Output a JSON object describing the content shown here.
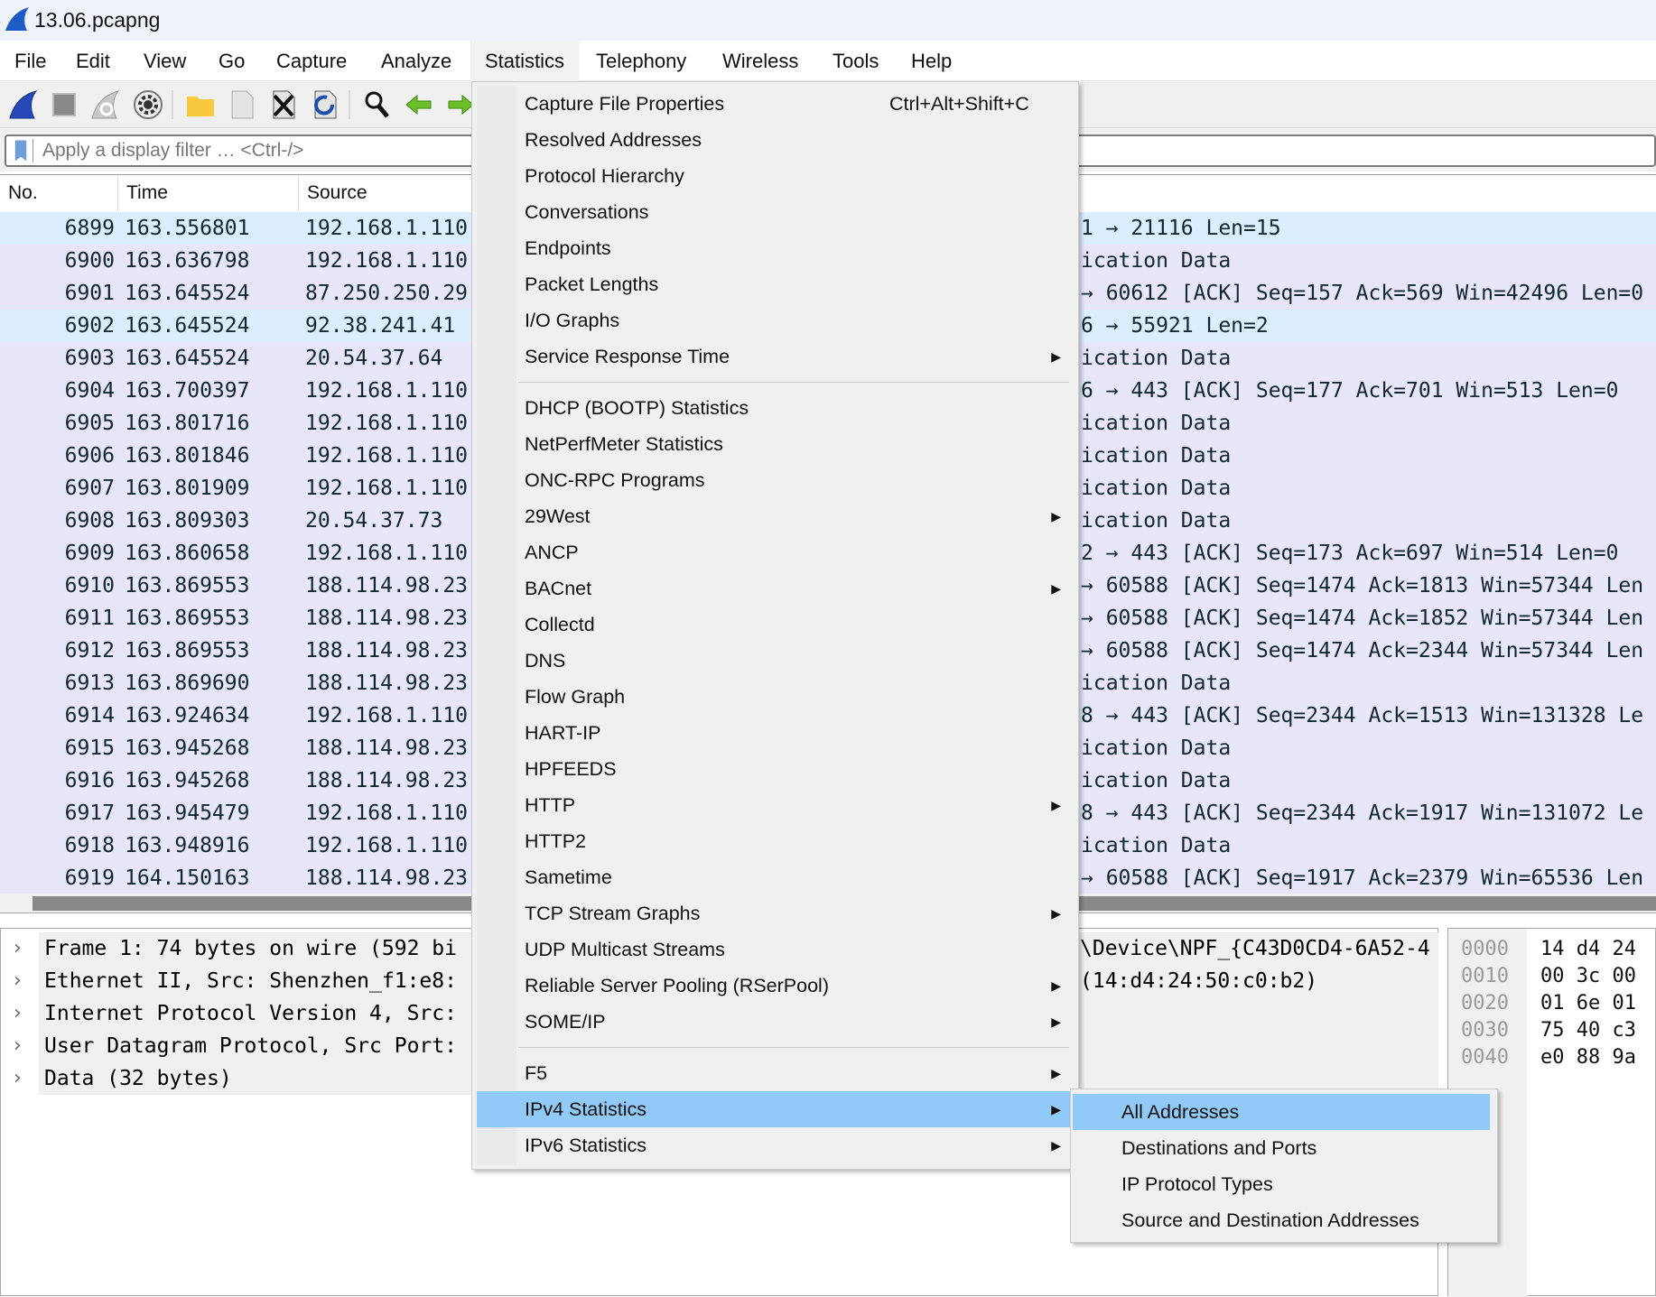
{
  "window": {
    "title": "13.06.pcapng",
    "icon": "wireshark-fin-icon"
  },
  "menubar": [
    "File",
    "Edit",
    "View",
    "Go",
    "Capture",
    "Analyze",
    "Statistics",
    "Telephony",
    "Wireless",
    "Tools",
    "Help"
  ],
  "menubar_active": "Statistics",
  "toolbar": [
    "start-capture-icon",
    "stop-capture-icon",
    "restart-capture-icon",
    "capture-options-icon",
    "open-file-icon",
    "save-file-icon",
    "close-file-icon",
    "reload-file-icon",
    "find-packet-icon",
    "go-back-icon",
    "go-forward-icon"
  ],
  "filter": {
    "placeholder": "Apply a display filter … <Ctrl-/>",
    "value": ""
  },
  "columns": [
    "No.",
    "Time",
    "Source"
  ],
  "colors": {
    "udp_row": "#dbeeff",
    "tcp_row": "#e7e6fb",
    "highlight": "#91c9f7"
  },
  "packets": [
    {
      "no": "6899",
      "time": "163.556801",
      "source": "192.168.1.110",
      "info": "1 → 21116 Len=15",
      "proto": "udp"
    },
    {
      "no": "6900",
      "time": "163.636798",
      "source": "192.168.1.110",
      "info": "ication Data",
      "proto": "tcp"
    },
    {
      "no": "6901",
      "time": "163.645524",
      "source": "87.250.250.29",
      "info": "→ 60612 [ACK] Seq=157 Ack=569 Win=42496 Len=0",
      "proto": "tcp"
    },
    {
      "no": "6902",
      "time": "163.645524",
      "source": "92.38.241.41",
      "info": "6 → 55921 Len=2",
      "proto": "udp"
    },
    {
      "no": "6903",
      "time": "163.645524",
      "source": "20.54.37.64",
      "info": "ication Data",
      "proto": "tcp"
    },
    {
      "no": "6904",
      "time": "163.700397",
      "source": "192.168.1.110",
      "info": "6 → 443 [ACK] Seq=177 Ack=701 Win=513 Len=0",
      "proto": "tcp"
    },
    {
      "no": "6905",
      "time": "163.801716",
      "source": "192.168.1.110",
      "info": "ication Data",
      "proto": "tcp"
    },
    {
      "no": "6906",
      "time": "163.801846",
      "source": "192.168.1.110",
      "info": "ication Data",
      "proto": "tcp"
    },
    {
      "no": "6907",
      "time": "163.801909",
      "source": "192.168.1.110",
      "info": "ication Data",
      "proto": "tcp"
    },
    {
      "no": "6908",
      "time": "163.809303",
      "source": "20.54.37.73",
      "info": "ication Data",
      "proto": "tcp"
    },
    {
      "no": "6909",
      "time": "163.860658",
      "source": "192.168.1.110",
      "info": "2 → 443 [ACK] Seq=173 Ack=697 Win=514 Len=0",
      "proto": "tcp"
    },
    {
      "no": "6910",
      "time": "163.869553",
      "source": "188.114.98.23",
      "info": "→ 60588 [ACK] Seq=1474 Ack=1813 Win=57344 Len",
      "proto": "tcp"
    },
    {
      "no": "6911",
      "time": "163.869553",
      "source": "188.114.98.23",
      "info": "→ 60588 [ACK] Seq=1474 Ack=1852 Win=57344 Len",
      "proto": "tcp"
    },
    {
      "no": "6912",
      "time": "163.869553",
      "source": "188.114.98.23",
      "info": "→ 60588 [ACK] Seq=1474 Ack=2344 Win=57344 Len",
      "proto": "tcp"
    },
    {
      "no": "6913",
      "time": "163.869690",
      "source": "188.114.98.23",
      "info": "ication Data",
      "proto": "tcp"
    },
    {
      "no": "6914",
      "time": "163.924634",
      "source": "192.168.1.110",
      "info": "8 → 443 [ACK] Seq=2344 Ack=1513 Win=131328 Le",
      "proto": "tcp"
    },
    {
      "no": "6915",
      "time": "163.945268",
      "source": "188.114.98.23",
      "info": "ication Data",
      "proto": "tcp"
    },
    {
      "no": "6916",
      "time": "163.945268",
      "source": "188.114.98.23",
      "info": "ication Data",
      "proto": "tcp"
    },
    {
      "no": "6917",
      "time": "163.945479",
      "source": "192.168.1.110",
      "info": "8 → 443 [ACK] Seq=2344 Ack=1917 Win=131072 Le",
      "proto": "tcp"
    },
    {
      "no": "6918",
      "time": "163.948916",
      "source": "192.168.1.110",
      "info": "ication Data",
      "proto": "tcp"
    },
    {
      "no": "6919",
      "time": "164.150163",
      "source": "188.114.98.23",
      "info": "→ 60588 [ACK] Seq=1917 Ack=2379 Win=65536 Len",
      "proto": "tcp"
    }
  ],
  "details": [
    {
      "left": "Frame 1: 74 bytes on wire (592 bi",
      "right": "\\Device\\NPF_{C43D0CD4-6A52-4"
    },
    {
      "left": "Ethernet II, Src: Shenzhen_f1:e8:",
      "right": "(14:d4:24:50:c0:b2)"
    },
    {
      "left": "Internet Protocol Version 4, Src:",
      "right": ""
    },
    {
      "left": "User Datagram Protocol, Src Port:",
      "right": ""
    },
    {
      "left": "Data (32 bytes)",
      "right": ""
    }
  ],
  "hex": [
    {
      "offset": "0000",
      "bytes": "14 d4 24"
    },
    {
      "offset": "0010",
      "bytes": "00 3c 00"
    },
    {
      "offset": "0020",
      "bytes": "01 6e 01"
    },
    {
      "offset": "0030",
      "bytes": "75 40 c3"
    },
    {
      "offset": "0040",
      "bytes": "e0 88 9a"
    }
  ],
  "statistics_menu": [
    [
      {
        "label": "Capture File Properties",
        "shortcut": "Ctrl+Alt+Shift+C"
      },
      {
        "label": "Resolved Addresses"
      },
      {
        "label": "Protocol Hierarchy"
      },
      {
        "label": "Conversations"
      },
      {
        "label": "Endpoints"
      },
      {
        "label": "Packet Lengths"
      },
      {
        "label": "I/O Graphs"
      },
      {
        "label": "Service Response Time",
        "submenu": true
      }
    ],
    [
      {
        "label": "DHCP (BOOTP) Statistics"
      },
      {
        "label": "NetPerfMeter Statistics"
      },
      {
        "label": "ONC-RPC Programs"
      },
      {
        "label": "29West",
        "submenu": true
      },
      {
        "label": "ANCP"
      },
      {
        "label": "BACnet",
        "submenu": true
      },
      {
        "label": "Collectd"
      },
      {
        "label": "DNS"
      },
      {
        "label": "Flow Graph"
      },
      {
        "label": "HART-IP"
      },
      {
        "label": "HPFEEDS"
      },
      {
        "label": "HTTP",
        "submenu": true
      },
      {
        "label": "HTTP2"
      },
      {
        "label": "Sametime"
      },
      {
        "label": "TCP Stream Graphs",
        "submenu": true
      },
      {
        "label": "UDP Multicast Streams"
      },
      {
        "label": "Reliable Server Pooling (RSerPool)",
        "submenu": true
      },
      {
        "label": "SOME/IP",
        "submenu": true
      }
    ],
    [
      {
        "label": "F5",
        "submenu": true
      },
      {
        "label": "IPv4 Statistics",
        "submenu": true,
        "highlighted": true
      },
      {
        "label": "IPv6 Statistics",
        "submenu": true
      }
    ]
  ],
  "ipv4_submenu": [
    {
      "label": "All Addresses",
      "highlighted": true
    },
    {
      "label": "Destinations and Ports"
    },
    {
      "label": "IP Protocol Types"
    },
    {
      "label": "Source and Destination Addresses"
    }
  ]
}
